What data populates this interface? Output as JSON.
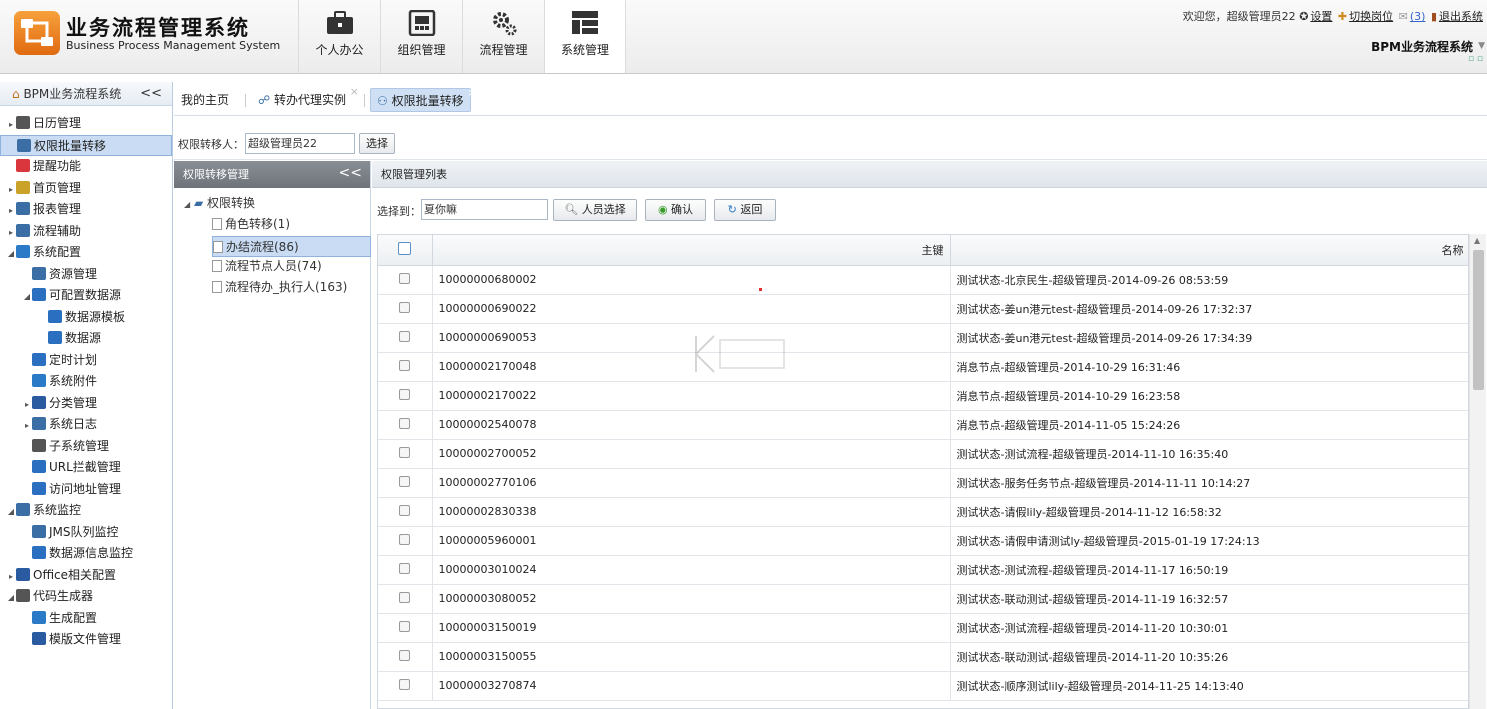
{
  "header": {
    "app_title": "业务流程管理系统",
    "app_subtitle": "Business Process Management System",
    "nav": [
      {
        "label": "个人办公",
        "icon": "briefcase-icon"
      },
      {
        "label": "组织管理",
        "icon": "org-chart-icon"
      },
      {
        "label": "流程管理",
        "icon": "gears-icon"
      },
      {
        "label": "系统管理",
        "icon": "layout-grid-icon",
        "active": true
      }
    ],
    "welcome": "欢迎您，超级管理员22",
    "settings": "设置",
    "switch_post": "切换岗位",
    "messages": "(3)",
    "logout": "退出系统",
    "system_name": "BPM业务流程系统",
    "accent_color": "#e57a1c"
  },
  "sidebar": {
    "title": "BPM业务流程系统",
    "collapse": "<<",
    "items": [
      {
        "label": "日历管理",
        "level": 0,
        "arrow": "▸",
        "icon": "calendar-icon"
      },
      {
        "label": "权限批量转移",
        "level": 0,
        "arrow": "",
        "icon": "users-icon",
        "selected": true
      },
      {
        "label": "提醒功能",
        "level": 0,
        "arrow": "",
        "icon": "heart-icon"
      },
      {
        "label": "首页管理",
        "level": 0,
        "arrow": "▸",
        "icon": "document-icon"
      },
      {
        "label": "报表管理",
        "level": 0,
        "arrow": "▸",
        "icon": "report-icon"
      },
      {
        "label": "流程辅助",
        "level": 0,
        "arrow": "▸",
        "icon": "flow-icon"
      },
      {
        "label": "系统配置",
        "level": 0,
        "arrow": "◢",
        "icon": "gear-icon"
      },
      {
        "label": "资源管理",
        "level": 1,
        "arrow": "",
        "icon": "resource-icon"
      },
      {
        "label": "可配置数据源",
        "level": 1,
        "arrow": "◢",
        "icon": "database-icon"
      },
      {
        "label": "数据源模板",
        "level": 2,
        "arrow": "",
        "icon": "database-icon"
      },
      {
        "label": "数据源",
        "level": 2,
        "arrow": "",
        "icon": "database-icon"
      },
      {
        "label": "定时计划",
        "level": 1,
        "arrow": "",
        "icon": "clock-icon"
      },
      {
        "label": "系统附件",
        "level": 1,
        "arrow": "",
        "icon": "attachment-icon"
      },
      {
        "label": "分类管理",
        "level": 1,
        "arrow": "▸",
        "icon": "category-icon"
      },
      {
        "label": "系统日志",
        "level": 1,
        "arrow": "▸",
        "icon": "log-icon"
      },
      {
        "label": "子系统管理",
        "level": 1,
        "arrow": "",
        "icon": "subsystem-icon"
      },
      {
        "label": "URL拦截管理",
        "level": 1,
        "arrow": "",
        "icon": "url-filter-icon"
      },
      {
        "label": "访问地址管理",
        "level": 1,
        "arrow": "",
        "icon": "address-icon"
      },
      {
        "label": "系统监控",
        "level": 0,
        "arrow": "◢",
        "icon": "monitor-icon"
      },
      {
        "label": "JMS队列监控",
        "level": 1,
        "arrow": "",
        "icon": "queue-icon"
      },
      {
        "label": "数据源信息监控",
        "level": 1,
        "arrow": "",
        "icon": "datasource-monitor-icon"
      },
      {
        "label": "Office相关配置",
        "level": 0,
        "arrow": "▸",
        "icon": "word-icon"
      },
      {
        "label": "代码生成器",
        "level": 0,
        "arrow": "◢",
        "icon": "code-icon"
      },
      {
        "label": "生成配置",
        "level": 1,
        "arrow": "",
        "icon": "gear-icon"
      },
      {
        "label": "模版文件管理",
        "level": 1,
        "arrow": "",
        "icon": "template-file-icon"
      }
    ]
  },
  "tabs": [
    {
      "label": "我的主页",
      "closable": false,
      "active": false
    },
    {
      "label": "转办代理实例",
      "closable": true,
      "active": false
    },
    {
      "label": "权限批量转移",
      "closable": true,
      "active": true
    }
  ],
  "transfer": {
    "label": "权限转移人：",
    "value": "超级管理员22",
    "select_button": "选择"
  },
  "mid_panel": {
    "title": "权限转移管理",
    "collapse": "<<",
    "root": "权限转换",
    "children": [
      {
        "label": "角色转移(1)",
        "selected": false
      },
      {
        "label": "办结流程(86)",
        "selected": true
      },
      {
        "label": "流程节点人员(74)",
        "selected": false
      },
      {
        "label": "流程待办_执行人(163)",
        "selected": false
      }
    ]
  },
  "grid_panel": {
    "title": "权限管理列表",
    "select_label": "选择到：",
    "select_value": "夏你嘛",
    "person_button": "人员选择",
    "confirm_button": "确认",
    "back_button": "返回",
    "columns": [
      "主键",
      "名称"
    ],
    "rows": [
      [
        "10000000680002",
        "测试状态-北京民生-超级管理员-2014-09-26 08:53:59"
      ],
      [
        "10000000690022",
        "测试状态-姜un港元test-超级管理员-2014-09-26 17:32:37"
      ],
      [
        "10000000690053",
        "测试状态-姜un港元test-超级管理员-2014-09-26 17:34:39"
      ],
      [
        "10000002170048",
        "消息节点-超级管理员-2014-10-29 16:31:46"
      ],
      [
        "10000002170022",
        "消息节点-超级管理员-2014-10-29 16:23:58"
      ],
      [
        "10000002540078",
        "消息节点-超级管理员-2014-11-05 15:24:26"
      ],
      [
        "10000002700052",
        "测试状态-测试流程-超级管理员-2014-11-10 16:35:40"
      ],
      [
        "10000002770106",
        "测试状态-服务任务节点-超级管理员-2014-11-11 10:14:27"
      ],
      [
        "10000002830338",
        "测试状态-请假lily-超级管理员-2014-11-12 16:58:32"
      ],
      [
        "10000005960001",
        "测试状态-请假申请测试ly-超级管理员-2015-01-19 17:24:13"
      ],
      [
        "10000003010024",
        "测试状态-测试流程-超级管理员-2014-11-17 16:50:19"
      ],
      [
        "10000003080052",
        "测试状态-联动测试-超级管理员-2014-11-19 16:32:57"
      ],
      [
        "10000003150019",
        "测试状态-测试流程-超级管理员-2014-11-20 10:30:01"
      ],
      [
        "10000003150055",
        "测试状态-联动测试-超级管理员-2014-11-20 10:35:26"
      ],
      [
        "10000003270874",
        "测试状态-顺序测试lily-超级管理员-2014-11-25 14:13:40"
      ]
    ]
  }
}
